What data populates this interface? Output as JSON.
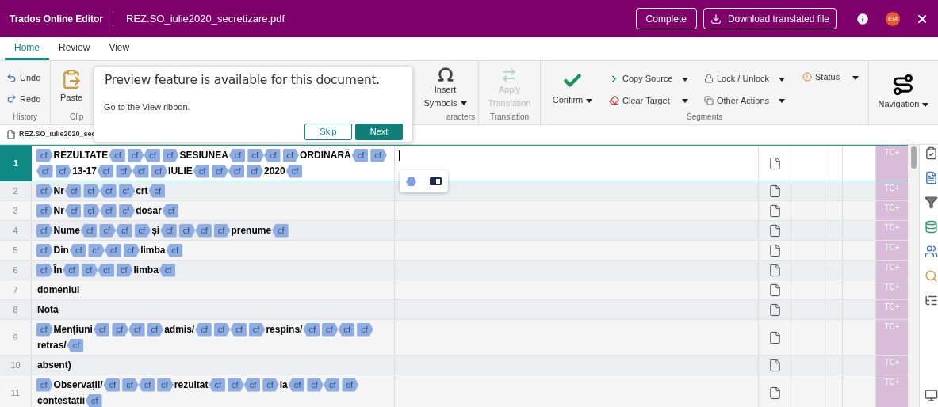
{
  "header": {
    "app_title": "Trados Online Editor",
    "file_name": "REZ.SO_iulie2020_secretizare.pdf",
    "buttons": [
      "Complete",
      "Download translated file"
    ],
    "avatar": "EM"
  },
  "tabs": [
    {
      "label": "Home",
      "selected": true
    },
    {
      "label": "Review",
      "selected": false
    },
    {
      "label": "View",
      "selected": false
    }
  ],
  "ribbon": {
    "history": {
      "undo": "Undo",
      "redo": "Redo",
      "label": "History"
    },
    "clipboard": {
      "paste": "Paste",
      "label": "Clip"
    },
    "characters": {
      "insert": "Insert",
      "symbols": "Symbols",
      "label": "aracters"
    },
    "translation": {
      "apply": "Apply",
      "apply2": "Translation",
      "label": "Translation",
      "disabled": true
    },
    "segments": {
      "confirm": "Confirm",
      "copy_source": "Copy Source",
      "clear_target": "Clear Target",
      "lock": "Lock / Unlock",
      "other": "Other Actions",
      "status": "Status",
      "label": "Segments"
    },
    "navigation": "Navigation"
  },
  "file_tab": "REZ.SO_iulie2020_sec",
  "popover": {
    "title": "Preview feature is available for this document.",
    "text": "Go to the View ribbon.",
    "skip": "Skip",
    "next": "Next"
  },
  "segments": [
    {
      "number": "1",
      "selected": true,
      "status": "TC+",
      "source": [
        {
          "kind": "open",
          "text": "cf"
        },
        {
          "kind": "text",
          "text": "REZULTATE"
        },
        {
          "kind": "close",
          "text": "cf"
        },
        {
          "kind": "open",
          "text": "cf"
        },
        {
          "kind": "close",
          "text": "cf"
        },
        {
          "kind": "open",
          "text": "cf"
        },
        {
          "kind": "text",
          "text": "SESIUNEA"
        },
        {
          "kind": "close",
          "text": "cf"
        },
        {
          "kind": "open",
          "text": "cf"
        },
        {
          "kind": "close",
          "text": "cf"
        },
        {
          "kind": "open",
          "text": "cf"
        },
        {
          "kind": "text",
          "text": "ORDINARĂ"
        },
        {
          "kind": "close",
          "text": "cf"
        },
        {
          "kind": "open",
          "text": "cf"
        },
        {
          "kind": "close",
          "text": "cf"
        },
        {
          "kind": "open",
          "text": "cf"
        },
        {
          "kind": "text",
          "text": "13-17"
        },
        {
          "kind": "close",
          "text": "cf"
        },
        {
          "kind": "open",
          "text": "cf"
        },
        {
          "kind": "close",
          "text": "cf"
        },
        {
          "kind": "open",
          "text": "cf"
        },
        {
          "kind": "text",
          "text": "IULIE"
        },
        {
          "kind": "close",
          "text": "cf"
        },
        {
          "kind": "open",
          "text": "cf"
        },
        {
          "kind": "close",
          "text": "cf"
        },
        {
          "kind": "open",
          "text": "cf"
        },
        {
          "kind": "text",
          "text": "2020"
        },
        {
          "kind": "close",
          "text": "cf"
        }
      ]
    },
    {
      "number": "2",
      "selected": false,
      "status": "TC+",
      "source": [
        {
          "kind": "open",
          "text": "cf"
        },
        {
          "kind": "text",
          "text": "Nr"
        },
        {
          "kind": "close",
          "text": "cf"
        },
        {
          "kind": "open",
          "text": "cf"
        },
        {
          "kind": "close",
          "text": "cf"
        },
        {
          "kind": "open",
          "text": "cf"
        },
        {
          "kind": "text",
          "text": "crt"
        },
        {
          "kind": "close",
          "text": "cf"
        }
      ]
    },
    {
      "number": "3",
      "selected": false,
      "status": "TC+",
      "source": [
        {
          "kind": "open",
          "text": "cf"
        },
        {
          "kind": "text",
          "text": "Nr"
        },
        {
          "kind": "close",
          "text": "cf"
        },
        {
          "kind": "open",
          "text": "cf"
        },
        {
          "kind": "close",
          "text": "cf"
        },
        {
          "kind": "open",
          "text": "cf"
        },
        {
          "kind": "text",
          "text": "dosar"
        },
        {
          "kind": "close",
          "text": "cf"
        }
      ]
    },
    {
      "number": "4",
      "selected": false,
      "status": "TC+",
      "source": [
        {
          "kind": "open",
          "text": "cf"
        },
        {
          "kind": "text",
          "text": "Nume"
        },
        {
          "kind": "close",
          "text": "cf"
        },
        {
          "kind": "open",
          "text": "cf"
        },
        {
          "kind": "close",
          "text": "cf"
        },
        {
          "kind": "open",
          "text": "cf"
        },
        {
          "kind": "text",
          "text": "și"
        },
        {
          "kind": "close",
          "text": "cf"
        },
        {
          "kind": "open",
          "text": "cf"
        },
        {
          "kind": "close",
          "text": "cf"
        },
        {
          "kind": "open",
          "text": "cf"
        },
        {
          "kind": "text",
          "text": "prenume"
        },
        {
          "kind": "close",
          "text": "cf"
        }
      ]
    },
    {
      "number": "5",
      "selected": false,
      "status": "TC+",
      "source": [
        {
          "kind": "open",
          "text": "cf"
        },
        {
          "kind": "text",
          "text": "Din"
        },
        {
          "kind": "close",
          "text": "cf"
        },
        {
          "kind": "open",
          "text": "cf"
        },
        {
          "kind": "close",
          "text": "cf"
        },
        {
          "kind": "open",
          "text": "cf"
        },
        {
          "kind": "text",
          "text": "limba"
        },
        {
          "kind": "close",
          "text": "cf"
        }
      ]
    },
    {
      "number": "6",
      "selected": false,
      "status": "TC+",
      "source": [
        {
          "kind": "open",
          "text": "cf"
        },
        {
          "kind": "text",
          "text": "În"
        },
        {
          "kind": "close",
          "text": "cf"
        },
        {
          "kind": "open",
          "text": "cf"
        },
        {
          "kind": "close",
          "text": "cf"
        },
        {
          "kind": "open",
          "text": "cf"
        },
        {
          "kind": "text",
          "text": "limba"
        },
        {
          "kind": "close",
          "text": "cf"
        }
      ]
    },
    {
      "number": "7",
      "selected": false,
      "status": "TC+",
      "source": [
        {
          "kind": "text",
          "text": "domeniul"
        }
      ]
    },
    {
      "number": "8",
      "selected": false,
      "status": "TC+",
      "source": [
        {
          "kind": "text",
          "text": "Nota"
        }
      ]
    },
    {
      "number": "9",
      "selected": false,
      "status": "TC+",
      "source": [
        {
          "kind": "open",
          "text": "cf"
        },
        {
          "kind": "text",
          "text": "Mențiuni"
        },
        {
          "kind": "close",
          "text": "cf"
        },
        {
          "kind": "open",
          "text": "cf"
        },
        {
          "kind": "close",
          "text": "cf"
        },
        {
          "kind": "open",
          "text": "cf"
        },
        {
          "kind": "text",
          "text": "admis/"
        },
        {
          "kind": "close",
          "text": "cf"
        },
        {
          "kind": "open",
          "text": "cf"
        },
        {
          "kind": "close",
          "text": "cf"
        },
        {
          "kind": "open",
          "text": "cf"
        },
        {
          "kind": "text",
          "text": "respins/"
        },
        {
          "kind": "close",
          "text": "cf"
        },
        {
          "kind": "open",
          "text": "cf"
        },
        {
          "kind": "close",
          "text": "cf"
        },
        {
          "kind": "open",
          "text": "cf"
        },
        {
          "kind": "text",
          "text": "retras/"
        },
        {
          "kind": "close",
          "text": "cf"
        }
      ]
    },
    {
      "number": "10",
      "selected": false,
      "status": "TC+",
      "source": [
        {
          "kind": "text",
          "text": "absent)"
        }
      ]
    },
    {
      "number": "11",
      "selected": false,
      "status": "TC+",
      "source": [
        {
          "kind": "open",
          "text": "cf"
        },
        {
          "kind": "text",
          "text": "Observații/"
        },
        {
          "kind": "close",
          "text": "cf"
        },
        {
          "kind": "open",
          "text": "cf"
        },
        {
          "kind": "close",
          "text": "cf"
        },
        {
          "kind": "open",
          "text": "cf"
        },
        {
          "kind": "text",
          "text": "rezultat"
        },
        {
          "kind": "close",
          "text": "cf"
        },
        {
          "kind": "open",
          "text": "cf"
        },
        {
          "kind": "close",
          "text": "cf"
        },
        {
          "kind": "open",
          "text": "cf"
        },
        {
          "kind": "text",
          "text": "la"
        },
        {
          "kind": "close",
          "text": "cf"
        },
        {
          "kind": "open",
          "text": "cf"
        },
        {
          "kind": "close",
          "text": "cf"
        },
        {
          "kind": "open",
          "text": "cf"
        },
        {
          "kind": "text",
          "text": "contestații"
        },
        {
          "kind": "close",
          "text": "cf"
        }
      ]
    }
  ]
}
